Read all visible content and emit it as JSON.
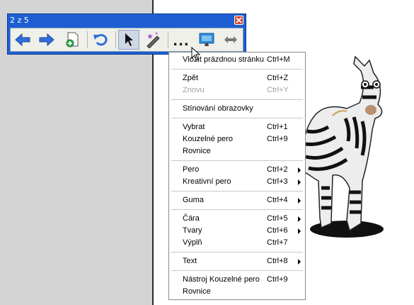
{
  "toolbar": {
    "title": "2 z 5",
    "buttons": [
      {
        "name": "previous-page",
        "icon": "arrow-left-icon"
      },
      {
        "name": "next-page",
        "icon": "arrow-right-icon"
      },
      {
        "name": "add-page",
        "icon": "add-page-icon"
      },
      {
        "name": "undo",
        "icon": "undo-icon"
      },
      {
        "name": "select",
        "icon": "cursor-arrow-icon"
      },
      {
        "name": "magic-pen",
        "icon": "magic-pen-icon"
      },
      {
        "name": "more",
        "icon": "more-icon",
        "label": "..."
      },
      {
        "name": "screen",
        "icon": "monitor-icon"
      },
      {
        "name": "move-toolbar",
        "icon": "double-arrow-icon"
      }
    ],
    "accent_color": "#1d5fd2"
  },
  "menu": {
    "items": [
      {
        "label": "Vložit prázdnou stránku",
        "shortcut": "Ctrl+M"
      },
      {
        "label": "Zpět",
        "shortcut": "Ctrl+Z"
      },
      {
        "label": "Znovu",
        "shortcut": "Ctrl+Y",
        "disabled": true
      },
      {
        "label": "Stínování obrazovky",
        "shortcut": ""
      },
      {
        "label": "Vybrat",
        "shortcut": "Ctrl+1"
      },
      {
        "label": "Kouzelné pero",
        "shortcut": "Ctrl+9"
      },
      {
        "label": "Rovnice",
        "shortcut": ""
      },
      {
        "label": "Pero",
        "shortcut": "Ctrl+2",
        "submenu": true
      },
      {
        "label": "Kreativní pero",
        "shortcut": "Ctrl+3",
        "submenu": true
      },
      {
        "label": "Guma",
        "shortcut": "Ctrl+4",
        "submenu": true
      },
      {
        "label": "Čára",
        "shortcut": "Ctrl+5",
        "submenu": true
      },
      {
        "label": "Tvary",
        "shortcut": "Ctrl+6",
        "submenu": true
      },
      {
        "label": "Výplň",
        "shortcut": "Ctrl+7"
      },
      {
        "label": "Text",
        "shortcut": "Ctrl+8",
        "submenu": true
      },
      {
        "label": "Nástroj Kouzelné pero",
        "shortcut": "Ctrl+9"
      },
      {
        "label": "Rovnice",
        "shortcut": ""
      }
    ]
  }
}
